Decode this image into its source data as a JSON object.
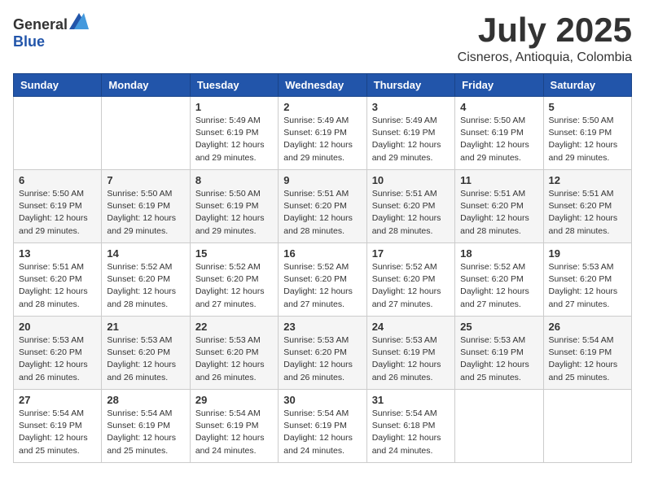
{
  "logo": {
    "general": "General",
    "blue": "Blue"
  },
  "header": {
    "month": "July 2025",
    "location": "Cisneros, Antioquia, Colombia"
  },
  "weekdays": [
    "Sunday",
    "Monday",
    "Tuesday",
    "Wednesday",
    "Thursday",
    "Friday",
    "Saturday"
  ],
  "weeks": [
    [
      {
        "day": null
      },
      {
        "day": null
      },
      {
        "day": "1",
        "sunrise": "Sunrise: 5:49 AM",
        "sunset": "Sunset: 6:19 PM",
        "daylight": "Daylight: 12 hours and 29 minutes."
      },
      {
        "day": "2",
        "sunrise": "Sunrise: 5:49 AM",
        "sunset": "Sunset: 6:19 PM",
        "daylight": "Daylight: 12 hours and 29 minutes."
      },
      {
        "day": "3",
        "sunrise": "Sunrise: 5:49 AM",
        "sunset": "Sunset: 6:19 PM",
        "daylight": "Daylight: 12 hours and 29 minutes."
      },
      {
        "day": "4",
        "sunrise": "Sunrise: 5:50 AM",
        "sunset": "Sunset: 6:19 PM",
        "daylight": "Daylight: 12 hours and 29 minutes."
      },
      {
        "day": "5",
        "sunrise": "Sunrise: 5:50 AM",
        "sunset": "Sunset: 6:19 PM",
        "daylight": "Daylight: 12 hours and 29 minutes."
      }
    ],
    [
      {
        "day": "6",
        "sunrise": "Sunrise: 5:50 AM",
        "sunset": "Sunset: 6:19 PM",
        "daylight": "Daylight: 12 hours and 29 minutes."
      },
      {
        "day": "7",
        "sunrise": "Sunrise: 5:50 AM",
        "sunset": "Sunset: 6:19 PM",
        "daylight": "Daylight: 12 hours and 29 minutes."
      },
      {
        "day": "8",
        "sunrise": "Sunrise: 5:50 AM",
        "sunset": "Sunset: 6:19 PM",
        "daylight": "Daylight: 12 hours and 29 minutes."
      },
      {
        "day": "9",
        "sunrise": "Sunrise: 5:51 AM",
        "sunset": "Sunset: 6:20 PM",
        "daylight": "Daylight: 12 hours and 28 minutes."
      },
      {
        "day": "10",
        "sunrise": "Sunrise: 5:51 AM",
        "sunset": "Sunset: 6:20 PM",
        "daylight": "Daylight: 12 hours and 28 minutes."
      },
      {
        "day": "11",
        "sunrise": "Sunrise: 5:51 AM",
        "sunset": "Sunset: 6:20 PM",
        "daylight": "Daylight: 12 hours and 28 minutes."
      },
      {
        "day": "12",
        "sunrise": "Sunrise: 5:51 AM",
        "sunset": "Sunset: 6:20 PM",
        "daylight": "Daylight: 12 hours and 28 minutes."
      }
    ],
    [
      {
        "day": "13",
        "sunrise": "Sunrise: 5:51 AM",
        "sunset": "Sunset: 6:20 PM",
        "daylight": "Daylight: 12 hours and 28 minutes."
      },
      {
        "day": "14",
        "sunrise": "Sunrise: 5:52 AM",
        "sunset": "Sunset: 6:20 PM",
        "daylight": "Daylight: 12 hours and 28 minutes."
      },
      {
        "day": "15",
        "sunrise": "Sunrise: 5:52 AM",
        "sunset": "Sunset: 6:20 PM",
        "daylight": "Daylight: 12 hours and 27 minutes."
      },
      {
        "day": "16",
        "sunrise": "Sunrise: 5:52 AM",
        "sunset": "Sunset: 6:20 PM",
        "daylight": "Daylight: 12 hours and 27 minutes."
      },
      {
        "day": "17",
        "sunrise": "Sunrise: 5:52 AM",
        "sunset": "Sunset: 6:20 PM",
        "daylight": "Daylight: 12 hours and 27 minutes."
      },
      {
        "day": "18",
        "sunrise": "Sunrise: 5:52 AM",
        "sunset": "Sunset: 6:20 PM",
        "daylight": "Daylight: 12 hours and 27 minutes."
      },
      {
        "day": "19",
        "sunrise": "Sunrise: 5:53 AM",
        "sunset": "Sunset: 6:20 PM",
        "daylight": "Daylight: 12 hours and 27 minutes."
      }
    ],
    [
      {
        "day": "20",
        "sunrise": "Sunrise: 5:53 AM",
        "sunset": "Sunset: 6:20 PM",
        "daylight": "Daylight: 12 hours and 26 minutes."
      },
      {
        "day": "21",
        "sunrise": "Sunrise: 5:53 AM",
        "sunset": "Sunset: 6:20 PM",
        "daylight": "Daylight: 12 hours and 26 minutes."
      },
      {
        "day": "22",
        "sunrise": "Sunrise: 5:53 AM",
        "sunset": "Sunset: 6:20 PM",
        "daylight": "Daylight: 12 hours and 26 minutes."
      },
      {
        "day": "23",
        "sunrise": "Sunrise: 5:53 AM",
        "sunset": "Sunset: 6:20 PM",
        "daylight": "Daylight: 12 hours and 26 minutes."
      },
      {
        "day": "24",
        "sunrise": "Sunrise: 5:53 AM",
        "sunset": "Sunset: 6:19 PM",
        "daylight": "Daylight: 12 hours and 26 minutes."
      },
      {
        "day": "25",
        "sunrise": "Sunrise: 5:53 AM",
        "sunset": "Sunset: 6:19 PM",
        "daylight": "Daylight: 12 hours and 25 minutes."
      },
      {
        "day": "26",
        "sunrise": "Sunrise: 5:54 AM",
        "sunset": "Sunset: 6:19 PM",
        "daylight": "Daylight: 12 hours and 25 minutes."
      }
    ],
    [
      {
        "day": "27",
        "sunrise": "Sunrise: 5:54 AM",
        "sunset": "Sunset: 6:19 PM",
        "daylight": "Daylight: 12 hours and 25 minutes."
      },
      {
        "day": "28",
        "sunrise": "Sunrise: 5:54 AM",
        "sunset": "Sunset: 6:19 PM",
        "daylight": "Daylight: 12 hours and 25 minutes."
      },
      {
        "day": "29",
        "sunrise": "Sunrise: 5:54 AM",
        "sunset": "Sunset: 6:19 PM",
        "daylight": "Daylight: 12 hours and 24 minutes."
      },
      {
        "day": "30",
        "sunrise": "Sunrise: 5:54 AM",
        "sunset": "Sunset: 6:19 PM",
        "daylight": "Daylight: 12 hours and 24 minutes."
      },
      {
        "day": "31",
        "sunrise": "Sunrise: 5:54 AM",
        "sunset": "Sunset: 6:18 PM",
        "daylight": "Daylight: 12 hours and 24 minutes."
      },
      {
        "day": null
      },
      {
        "day": null
      }
    ]
  ]
}
